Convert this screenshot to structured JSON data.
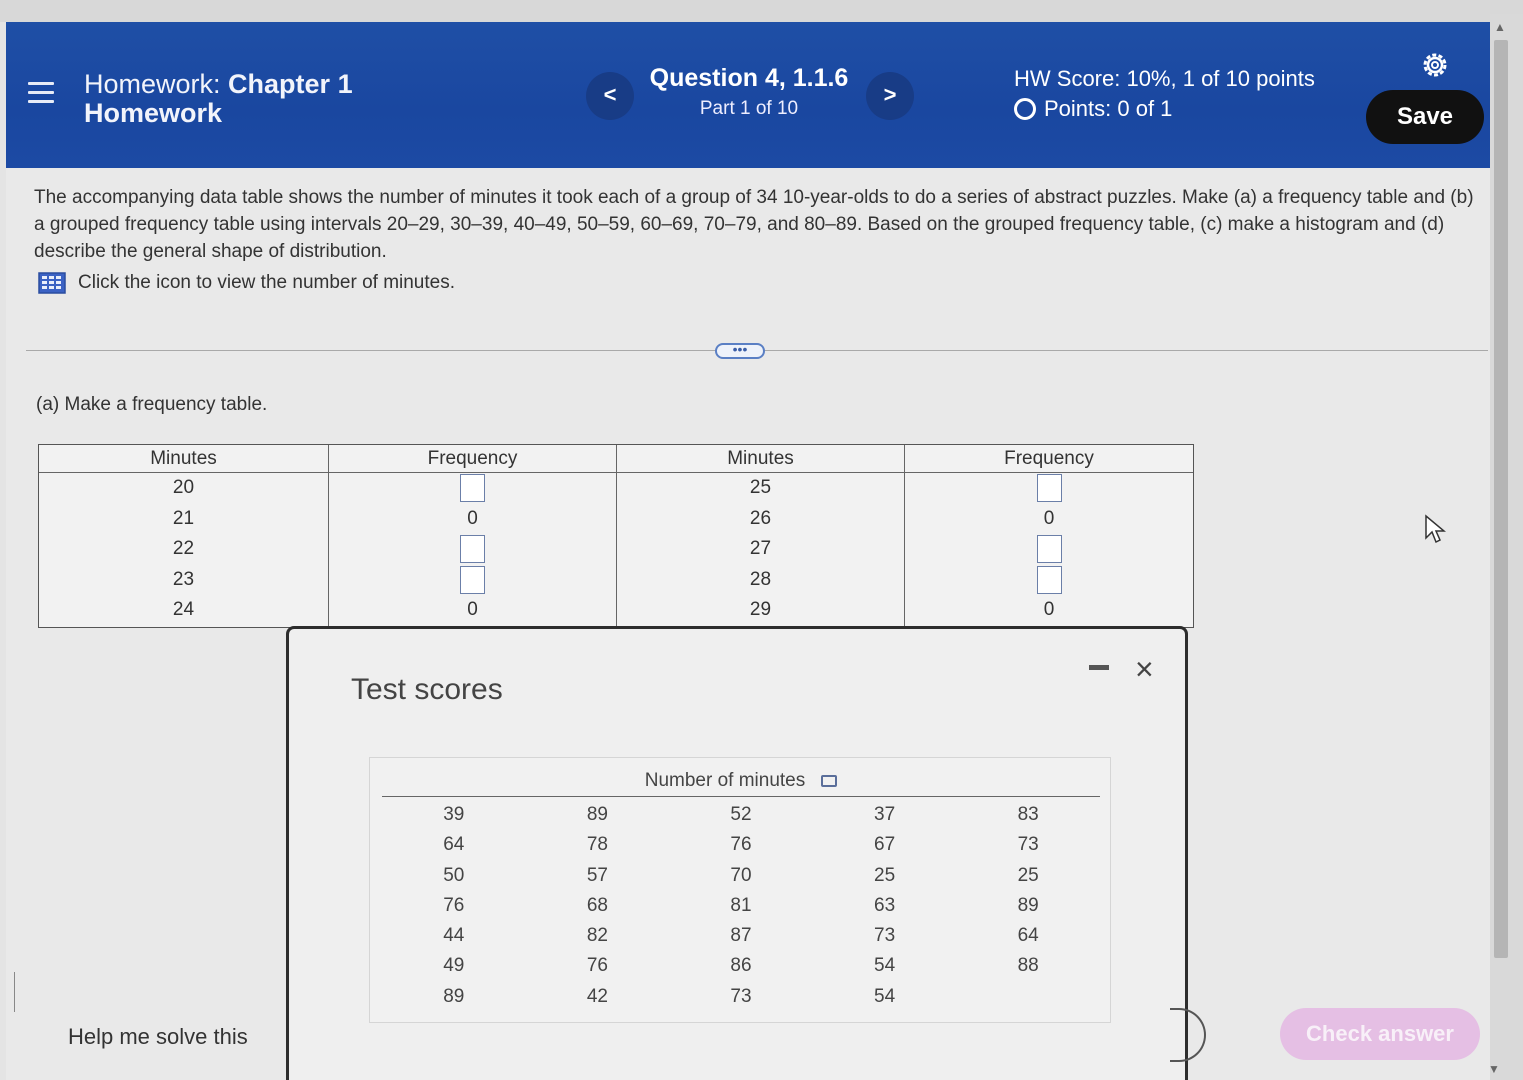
{
  "header": {
    "title_light": "Homework:",
    "title_bold": "Chapter 1",
    "title_line2": "Homework",
    "question_title": "Question 4, 1.1.6",
    "question_part": "Part 1 of 10",
    "prev_label": "<",
    "next_label": ">",
    "hw_score": "HW Score: 10%, 1 of 10 points",
    "points": "Points: 0 of 1",
    "save_label": "Save",
    "icons": {
      "menu": "hamburger-icon",
      "settings": "gear-icon"
    }
  },
  "problem": {
    "text": "The accompanying data table shows the number of minutes it took each of a group of 34 10-year-olds to do a series of abstract puzzles. Make (a) a frequency table and (b) a grouped frequency table using intervals 20–29, 30–39, 40–49, 50–59, 60–69, 70–79, and 80–89. Based on the grouped frequency table, (c) make a histogram and (d) describe the general shape of distribution.",
    "data_link": "Click the icon to view the number of minutes.",
    "expander_label": "•••"
  },
  "part_a": {
    "prompt": "(a) Make a frequency table.",
    "headers": [
      "Minutes",
      "Frequency",
      "Minutes",
      "Frequency"
    ],
    "left_minutes": [
      "20",
      "21",
      "22",
      "23",
      "24"
    ],
    "left_freq": [
      "",
      "0",
      "",
      "",
      "0"
    ],
    "right_minutes": [
      "25",
      "26",
      "27",
      "28",
      "29"
    ],
    "right_freq": [
      "",
      "0",
      "",
      "",
      "0"
    ]
  },
  "dialog": {
    "title": "Test scores",
    "minimize_label": "–",
    "close_label": "×",
    "table_header": "Number of minutes",
    "rows": [
      [
        "39",
        "89",
        "52",
        "37",
        "83"
      ],
      [
        "64",
        "78",
        "76",
        "67",
        "73"
      ],
      [
        "50",
        "57",
        "70",
        "25",
        "25"
      ],
      [
        "76",
        "68",
        "81",
        "63",
        "89"
      ],
      [
        "44",
        "82",
        "87",
        "73",
        "64"
      ],
      [
        "49",
        "76",
        "86",
        "54",
        "88"
      ],
      [
        "89",
        "42",
        "73",
        "54",
        ""
      ]
    ]
  },
  "footer": {
    "help_label": "Help me solve this",
    "check_label": "Check answer"
  },
  "colors": {
    "header_blue": "#1f4fa6",
    "save_bg": "#111111",
    "check_bg": "#e5bfe4"
  }
}
